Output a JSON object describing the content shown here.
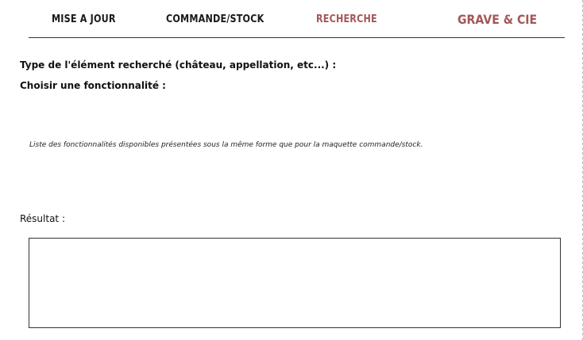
{
  "nav": {
    "items": [
      {
        "label": "MISE A JOUR",
        "color": "#1a1a1a"
      },
      {
        "label": "COMMANDE/STOCK",
        "color": "#1a1a1a"
      },
      {
        "label": "RECHERCHE",
        "color": "#a45757"
      }
    ],
    "brand": "GRAVE & CIE",
    "brand_color": "#a45757"
  },
  "form": {
    "type_label": "Type de l'élément recherché (château, appellation, etc...) :",
    "function_label": "Choisir une fonctionnalité :",
    "note": "Liste des fonctionnalités disponibles présentées sous la même forme que pour la maquette commande/stock.",
    "result_label": "Résultat :",
    "result_value": ""
  }
}
